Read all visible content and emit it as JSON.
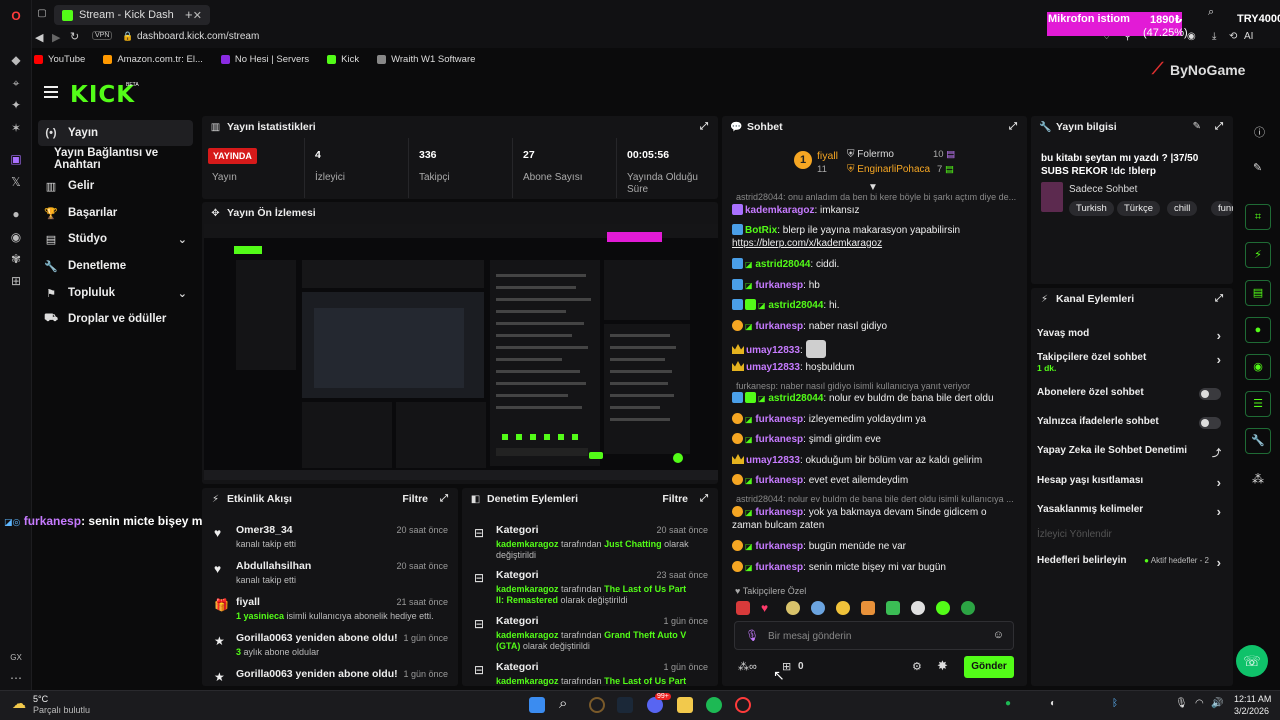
{
  "browser": {
    "tab_title": "Stream - Kick Dashboa",
    "vpn_label": "VPN",
    "url": "dashboard.kick.com/stream",
    "bookmarks": [
      "YouTube",
      "Amazon.com.tr: El...",
      "No Hesi | Servers",
      "Kick",
      "Wraith W1 Software"
    ],
    "ai_label": "AI"
  },
  "overlay": {
    "mic_label": "Mikrofon istiom",
    "mic_amount": "1890₺",
    "mic_percent": "(47.25%)",
    "goal_label": "TRY4000",
    "progress": 0.4725,
    "watermark": "ByNoGame",
    "chat_overlay_user": "furkanesp",
    "chat_overlay_text": ": senin micte bişey mi var bugün",
    "gx": "GX"
  },
  "app": {
    "logo": "KICK",
    "beta": "BETA",
    "nav": [
      {
        "label": "Yayın",
        "icon": "(•)"
      },
      {
        "label": "Yayın Bağlantısı ve Anahtarı",
        "icon": ""
      },
      {
        "label": "Gelir",
        "icon": "▥"
      },
      {
        "label": "Başarılar",
        "icon": "🏆"
      },
      {
        "label": "Stüdyo",
        "icon": "▤"
      },
      {
        "label": "Denetleme",
        "icon": "🔧"
      },
      {
        "label": "Topluluk",
        "icon": "⚑"
      },
      {
        "label": "Droplar ve ödüller",
        "icon": "⛟"
      }
    ]
  },
  "stats": {
    "title": "Yayın İstatistikleri",
    "live_badge": "YAYINDA",
    "items": [
      {
        "value": "",
        "label": "Yayın"
      },
      {
        "value": "4",
        "label": "İzleyici"
      },
      {
        "value": "336",
        "label": "Takipçi"
      },
      {
        "value": "27",
        "label": "Abone Sayısı"
      },
      {
        "value": "00:05:56",
        "label": "Yayında Olduğu Süre"
      }
    ]
  },
  "preview": {
    "title": "Yayın Ön İzlemesi"
  },
  "activity": {
    "title": "Etkinlik Akışı",
    "filter": "Filtre",
    "items": [
      {
        "title": "Omer38_34",
        "sub": "kanalı takip etti",
        "time": "20 saat önce",
        "icon": "♥"
      },
      {
        "title": "Abdullahsilhan",
        "sub": "kanalı takip etti",
        "time": "20 saat önce",
        "icon": "♥"
      },
      {
        "title": "fiyall",
        "sub_green": "1 yasinieca",
        "sub": " isimli kullanıcıya abonelik hediye etti.",
        "time": "21 saat önce",
        "icon": "🎁"
      },
      {
        "title": "Gorilla0063 yeniden abone oldu!",
        "sub_green": "3",
        "sub": " aylık abone oldular",
        "time": "1 gün önce",
        "icon": "★"
      },
      {
        "title": "Gorilla0063 yeniden abone oldu!",
        "sub": "",
        "time": "1 gün önce",
        "icon": "★"
      }
    ]
  },
  "moderation": {
    "title": "Denetim Eylemleri",
    "filter": "Filtre",
    "items": [
      {
        "title": "Kategori",
        "mod": "kademkaragoz",
        "mid": " tarafından ",
        "cat": "Just Chatting",
        "end": " olarak değiştirildi",
        "time": "20 saat önce"
      },
      {
        "title": "Kategori",
        "mod": "kademkaragoz",
        "mid": " tarafından ",
        "cat": "The Last of Us Part II: Remastered",
        "end": " olarak değiştirildi",
        "time": "23 saat önce"
      },
      {
        "title": "Kategori",
        "mod": "kademkaragoz",
        "mid": " tarafından ",
        "cat": "Grand Theft Auto V (GTA)",
        "end": " olarak değiştirildi",
        "time": "1 gün önce"
      },
      {
        "title": "Kategori",
        "mod": "kademkaragoz",
        "mid": " tarafından ",
        "cat": "The Last of Us Part II:",
        "end": "",
        "time": "1 gün önce"
      }
    ]
  },
  "chat": {
    "title": "Sohbet",
    "pinned": [
      {
        "name": "fiyall",
        "count": "11"
      },
      {
        "name": "Folermo",
        "count": "10"
      },
      {
        "name": "EnginarliPohaca",
        "count": "7"
      }
    ],
    "reply_top": "astrid28044: onu anladım da ben bi kere böyle bi şarkı açtım diye de...",
    "messages": [
      {
        "user": "kademkaragoz",
        "color": "#c67bff",
        "text": ": imkansız",
        "badge": "sq"
      },
      {
        "user": "BotRix",
        "color": "#53fc18",
        "text": ": blerp ile yayına makarasyon yapabilirsin",
        "badge": "sq"
      },
      {
        "user": "",
        "color": "#fff",
        "text": "https://blerp.com/x/kademkaragoz",
        "badge": ""
      },
      {
        "user": "astrid28044",
        "color": "#53fc18",
        "text": ": ciddi.",
        "badge": "sq"
      },
      {
        "user": "furkanesp",
        "color": "#c67bff",
        "text": ": hb",
        "badge": "coin"
      },
      {
        "user": "astrid28044",
        "color": "#53fc18",
        "text": ": hi.",
        "badge": "sq"
      },
      {
        "user": "furkanesp",
        "color": "#c67bff",
        "text": ": naber nasıl gidiyo",
        "badge": "coin"
      },
      {
        "user": "umay12833",
        "color": "#c67bff",
        "text": ":",
        "badge": "crown"
      },
      {
        "user": "umay12833",
        "color": "#c67bff",
        "text": ": hoşbuldum",
        "badge": "crown"
      },
      {
        "user": "astrid28044",
        "color": "#53fc18",
        "text": ": nolur ev buldm de bana bile dert oldu",
        "badge": "sq"
      },
      {
        "user": "furkanesp",
        "color": "#c67bff",
        "text": ": izleyemedim yoldaydım ya",
        "badge": "coin"
      },
      {
        "user": "furkanesp",
        "color": "#c67bff",
        "text": ": şimdi girdim eve",
        "badge": "coin"
      },
      {
        "user": "umay12833",
        "color": "#c67bff",
        "text": ": okuduğum bir bölüm var az kaldı gelirim",
        "badge": "crown"
      },
      {
        "user": "furkanesp",
        "color": "#c67bff",
        "text": ": evet evet ailemdeydim",
        "badge": "coin"
      },
      {
        "user": "furkanesp",
        "color": "#c67bff",
        "text": ": yok ya bakmaya devam 5inde gidicem o zaman bulcam zaten",
        "badge": "coin"
      },
      {
        "user": "furkanesp",
        "color": "#c67bff",
        "text": ": bugün menüde ne var",
        "badge": "coin"
      },
      {
        "user": "furkanesp",
        "color": "#c67bff",
        "text": ": senin micte bişey mi var bugün",
        "badge": "coin"
      }
    ],
    "reply_mid": "furkanesp: naber nasıl gidiyo isimli kullanıcıya yanıt veriyor",
    "reply_low": "astrid28044: nolur ev buldm de bana bile dert oldu isimli kullanıcıya ...",
    "followers_only": "Takipçilere Özel",
    "input_placeholder": "Bir mesaj gönderin",
    "points": "0",
    "send": "Gönder"
  },
  "stream_info": {
    "title": "Yayın bilgisi",
    "stream_title": "bu kitabı şeytan mı yazdı ? |37/50 SUBS REKOR !dc !blerp",
    "category": "Sadece Sohbet",
    "tags": [
      "Turkish",
      "Türkçe",
      "chill",
      "funn"
    ]
  },
  "channel_actions": {
    "title": "Kanal Eylemleri",
    "rows": [
      {
        "label": "Yavaş mod",
        "control": "arrow"
      },
      {
        "label": "Takipçilere özel sohbet",
        "sub": "1 dk.",
        "control": "arrow"
      },
      {
        "label": "Abonelere özel sohbet",
        "control": "toggle"
      },
      {
        "label": "Yalnızca ifadelerle sohbet",
        "control": "toggle"
      },
      {
        "label": "Yapay Zeka ile Sohbet Denetimi",
        "control": "external"
      },
      {
        "label": "Hesap yaşı kısıtlaması",
        "control": "arrow"
      },
      {
        "label": "Yasaklanmış kelimeler",
        "control": "arrow"
      },
      {
        "label": "İzleyici Yönlendir",
        "control": "none",
        "disabled": true
      },
      {
        "label": "Hedefleri belirleyin",
        "extra": "Aktif hedefler - 2",
        "control": "arrow"
      }
    ]
  },
  "taskbar": {
    "temp": "5°C",
    "weather": "Parçalı bulutlu",
    "time": "12:11 AM",
    "date": "3/2/2026",
    "badge": "99+"
  },
  "colors": {
    "kick_green": "#53fc18",
    "live_red": "#d61a1a",
    "panel_bg": "#141416",
    "overlay_pink": "#e21bd6"
  }
}
